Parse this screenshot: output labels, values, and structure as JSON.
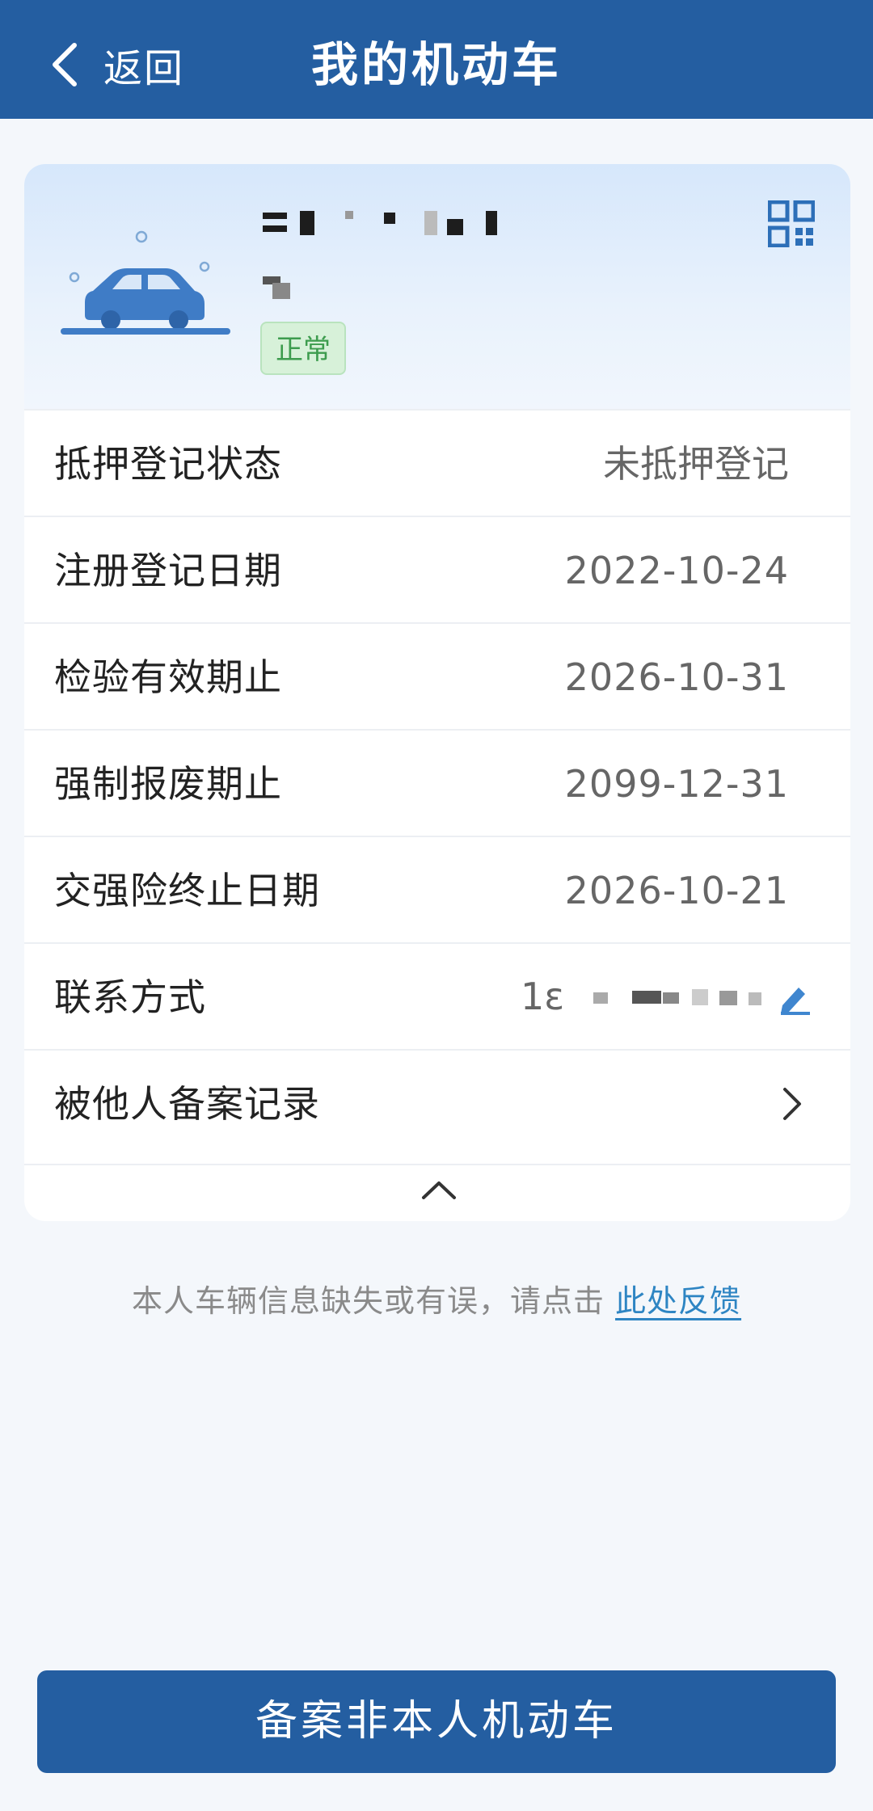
{
  "header": {
    "back_label": "返回",
    "title": "我的机动车"
  },
  "vehicle": {
    "status": "正常",
    "icons": {
      "qr": "qr-code-icon",
      "car": "car-icon"
    }
  },
  "details": {
    "mortgage": {
      "label": "抵押登记状态",
      "value": "未抵押登记"
    },
    "registration_date": {
      "label": "注册登记日期",
      "value": "2022-10-24"
    },
    "inspection_valid_until": {
      "label": "检验有效期止",
      "value": "2026-10-31"
    },
    "scrap_deadline": {
      "label": "强制报废期止",
      "value": "2099-12-31"
    },
    "insurance_end_date": {
      "label": "交强险终止日期",
      "value": "2026-10-21"
    },
    "contact": {
      "label": "联系方式",
      "value_prefix": "1ε"
    },
    "records": {
      "label": "被他人备案记录"
    }
  },
  "feedback": {
    "text": "本人车辆信息缺失或有误，请点击",
    "link": "此处反馈"
  },
  "bottom_button": {
    "label": "备案非本人机动车"
  },
  "colors": {
    "brand": "#245ea1",
    "status_green": "#3d9c4e",
    "link": "#2e85c3"
  }
}
